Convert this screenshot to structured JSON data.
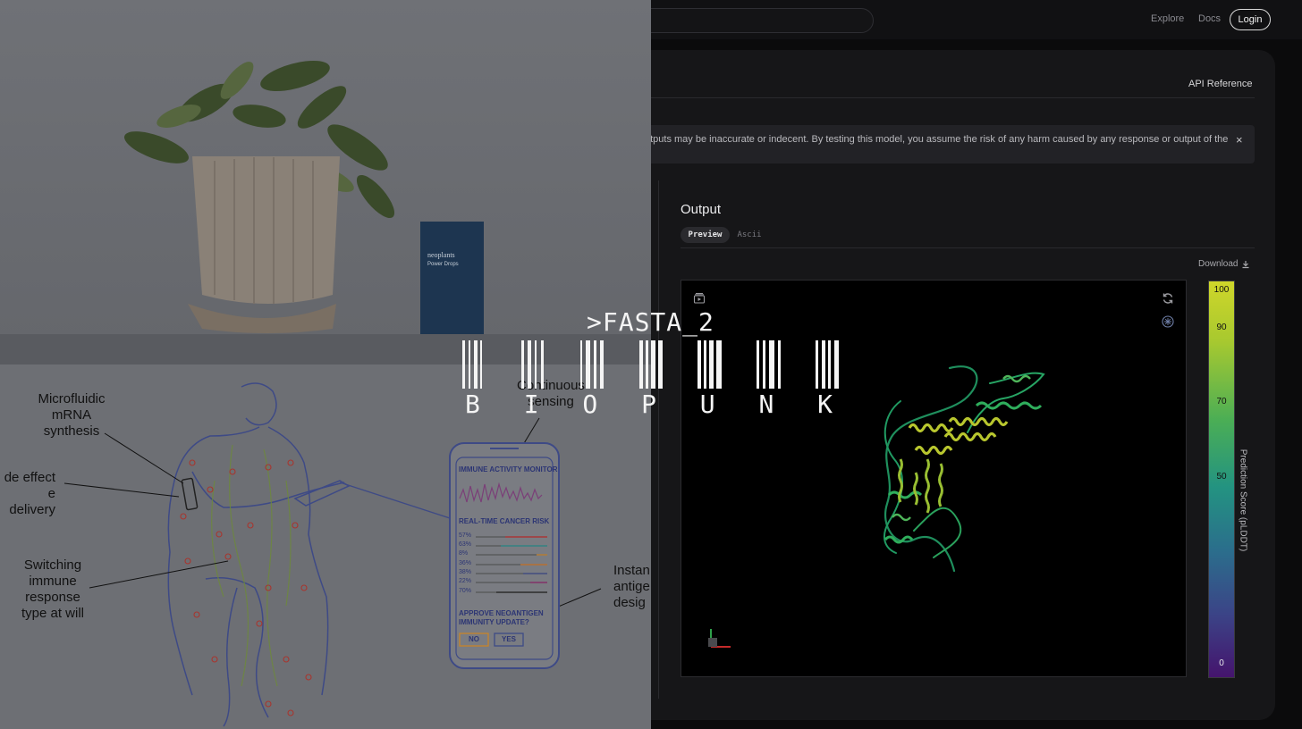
{
  "nav": {
    "explore": "Explore",
    "docs": "Docs",
    "login": "Login"
  },
  "panel": {
    "api_reference": "API Reference",
    "warning": "utputs may be inaccurate or indecent. By testing this model, you assume the risk of any harm caused by any response or output of the",
    "close": "×",
    "output_title": "Output",
    "tabs": [
      "Preview",
      "Ascii"
    ],
    "download": "Download"
  },
  "colorbar": {
    "ticks": [
      "100",
      "90",
      "70",
      "50",
      "0"
    ],
    "axis_label": "Prediction Score (pLDDT)"
  },
  "overlay": {
    "product": {
      "brand": "neoplants",
      "name": "Power Drops"
    },
    "callouts": {
      "microfluidic": "Microfluidic mRNA synthesis",
      "side_effect": "de effect e delivery",
      "switching": "Switching immune response type at will",
      "continuous": "Continuous sensing",
      "instant": "Instan antige desig"
    },
    "phone": {
      "title": "IMMUNE ACTIVITY MONITOR",
      "risk_title": "REAL-TIME CANCER RISK",
      "risks": [
        "57%",
        "63%",
        "8%",
        "36%",
        "38%",
        "22%",
        "70%"
      ],
      "question": "APPROVE NEOANTIGEN IMMUNITY UPDATE?",
      "no": "NO",
      "yes": "YES"
    }
  },
  "logo": {
    "fasta": ">FASTA_2",
    "letters": [
      "B",
      "I",
      "O",
      "P",
      "U",
      "N",
      "K"
    ]
  },
  "colors": {
    "accent_yellow": "#cfd62a",
    "accent_green": "#2ea06a",
    "accent_purple": "#45146d"
  }
}
